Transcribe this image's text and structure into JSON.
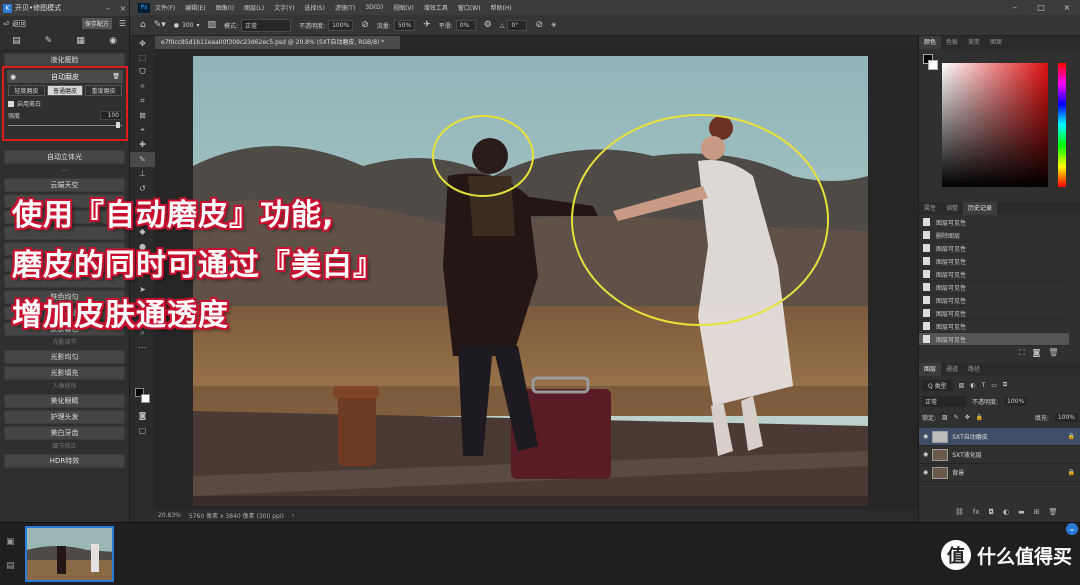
{
  "plugin": {
    "title": "开贝•修图模式",
    "back_label": "返回",
    "save_label": "保存配方",
    "buttons_top": [
      "液化瘦脸"
    ],
    "auto_smooth": {
      "label": "自动磨皮",
      "tabs": [
        "轻度磨皮",
        "普通磨皮",
        "重度磨皮"
      ],
      "active_tab": 1,
      "checkbox_label": "启用美白",
      "strength_label": "强度",
      "strength_value": "100"
    },
    "buttons_mid": [
      "自动立体光",
      "云端天空"
    ],
    "blemish_buttons": [
      "肤色均匀",
      "皮肤通透",
      "皮肤着色"
    ],
    "section_light": "光影调节",
    "light_buttons": [
      "光影均匀",
      "光影填充"
    ],
    "section_portrait": "人像修饰",
    "portrait_buttons": [
      "美化眼睛",
      "护理头发",
      "美白牙齿"
    ],
    "section_detail": "细节修正",
    "detail_buttons": [
      "HDR特效"
    ]
  },
  "menubar": {
    "items": [
      "文件(F)",
      "编辑(E)",
      "图像(I)",
      "图层(L)",
      "文字(Y)",
      "选择(S)",
      "滤镜(T)",
      "3D(D)",
      "视图(V)",
      "增效工具",
      "窗口(W)",
      "帮助(H)"
    ]
  },
  "optbar": {
    "mode_label": "模式:",
    "mode_value": "正常",
    "opacity_label": "不透明度:",
    "opacity_value": "100%",
    "flow_label": "流量:",
    "flow_value": "50%",
    "smooth_label": "平滑:",
    "smooth_value": "0%",
    "angle_value": "0°",
    "brush_size": "300"
  },
  "document": {
    "tab_label": "e7f0cc85d1b11eaa00f309c23d62ec5.psd @ 20.8% (SXT自动磨皮, RGB/8) *",
    "zoom": "20.83%",
    "dims": "5760 像素 x 3840 像素 (300 ppi)"
  },
  "right": {
    "color_tabs": [
      "颜色",
      "色板",
      "渐变",
      "图案"
    ],
    "props_tabs": [
      "属性",
      "调整",
      "历史记录"
    ],
    "history": [
      "图层可见性",
      "删除图层",
      "图层可见性",
      "图层可见性",
      "图层可见性",
      "图层可见性",
      "图层可见性",
      "图层可见性",
      "图层可见性",
      "图层可见性"
    ],
    "layers_tabs": [
      "图层",
      "通道",
      "路径"
    ],
    "blend_mode": "正常",
    "opacity_label": "不透明度:",
    "opacity_value": "100%",
    "lock_label": "锁定:",
    "fill_label": "填充:",
    "fill_value": "100%",
    "kind_label": "Q 类型",
    "layers": [
      "SXT自动磨皮",
      "SXT液化层",
      "背景"
    ]
  },
  "caption": {
    "line1": "使用『自动磨皮』功能,",
    "line2": "磨皮的同时可通过『美白』",
    "line3": "增加皮肤通透度"
  },
  "watermark": {
    "text": "什么值得买",
    "icon_glyph": "值"
  },
  "colors": {
    "accent": "#2b7bd6",
    "highlight_red": "#e01b1b",
    "annotation_yellow": "#e6e23a"
  }
}
